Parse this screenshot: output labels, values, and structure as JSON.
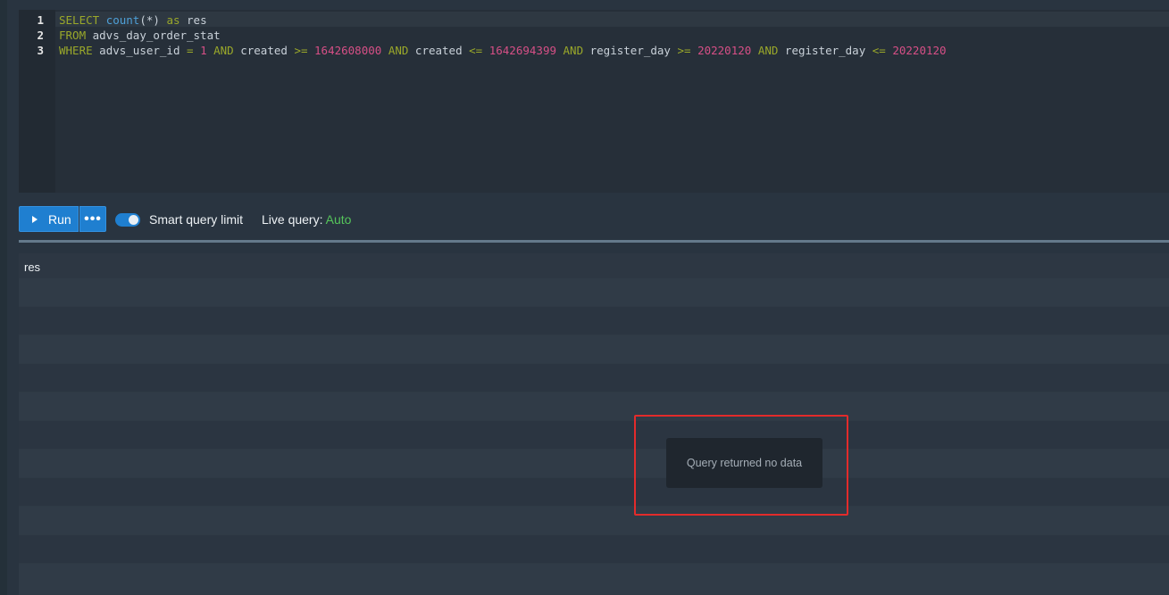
{
  "editor": {
    "line_numbers": [
      "1",
      "2",
      "3"
    ],
    "lines": [
      [
        {
          "t": "SELECT",
          "c": "kw"
        },
        {
          "t": " ",
          "c": "id"
        },
        {
          "t": "count",
          "c": "fn"
        },
        {
          "t": "(*)",
          "c": "id"
        },
        {
          "t": " ",
          "c": "id"
        },
        {
          "t": "as",
          "c": "kw"
        },
        {
          "t": " res",
          "c": "id"
        }
      ],
      [
        {
          "t": "FROM",
          "c": "kw"
        },
        {
          "t": " advs_day_order_stat",
          "c": "id"
        }
      ],
      [
        {
          "t": "WHERE",
          "c": "kw"
        },
        {
          "t": " advs_user_id ",
          "c": "id"
        },
        {
          "t": "=",
          "c": "op"
        },
        {
          "t": " ",
          "c": "id"
        },
        {
          "t": "1",
          "c": "num"
        },
        {
          "t": " ",
          "c": "id"
        },
        {
          "t": "AND",
          "c": "kw"
        },
        {
          "t": " created ",
          "c": "id"
        },
        {
          "t": ">=",
          "c": "op"
        },
        {
          "t": " ",
          "c": "id"
        },
        {
          "t": "1642608000",
          "c": "num"
        },
        {
          "t": " ",
          "c": "id"
        },
        {
          "t": "AND",
          "c": "kw"
        },
        {
          "t": " created ",
          "c": "id"
        },
        {
          "t": "<=",
          "c": "op"
        },
        {
          "t": " ",
          "c": "id"
        },
        {
          "t": "1642694399",
          "c": "num"
        },
        {
          "t": " ",
          "c": "id"
        },
        {
          "t": "AND",
          "c": "kw"
        },
        {
          "t": " register_day ",
          "c": "id"
        },
        {
          "t": ">=",
          "c": "op"
        },
        {
          "t": " ",
          "c": "id"
        },
        {
          "t": "20220120",
          "c": "num"
        },
        {
          "t": " ",
          "c": "id"
        },
        {
          "t": "AND",
          "c": "kw"
        },
        {
          "t": " register_day ",
          "c": "id"
        },
        {
          "t": "<=",
          "c": "op"
        },
        {
          "t": " ",
          "c": "id"
        },
        {
          "t": "20220120",
          "c": "num"
        }
      ]
    ]
  },
  "toolbar": {
    "run_label": "Run",
    "more_label": "•••",
    "smart_limit_label": "Smart query limit",
    "smart_limit_enabled": true,
    "live_query_label": "Live query:",
    "live_query_value": "Auto"
  },
  "results": {
    "columns": [
      "res"
    ],
    "empty_message": "Query returned no data"
  },
  "colors": {
    "accent": "#1f7fd0",
    "live_value": "#55c45a",
    "highlight": "#e32b2b"
  }
}
